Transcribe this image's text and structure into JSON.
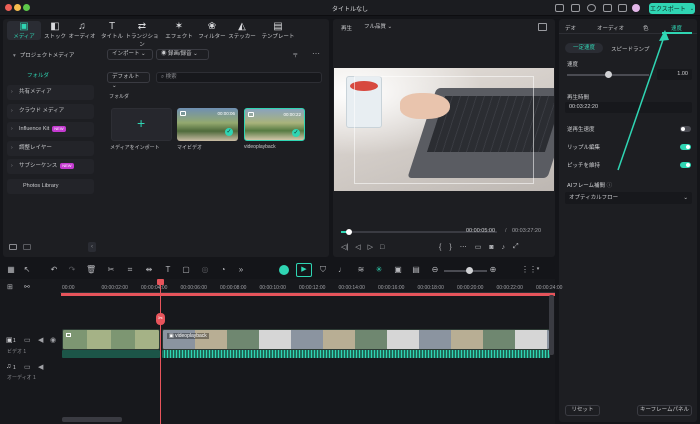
{
  "window": {
    "title": "タイトルなし",
    "export_label": "エクスポート"
  },
  "media_tabs": [
    {
      "label": "メディア",
      "icon": "media-icon",
      "glyph": "▣"
    },
    {
      "label": "ストック",
      "icon": "stock-icon",
      "glyph": "◧"
    },
    {
      "label": "オーディオ",
      "icon": "audio-icon",
      "glyph": "♫"
    },
    {
      "label": "タイトル",
      "icon": "title-icon",
      "glyph": "T"
    },
    {
      "label": "トランジション",
      "icon": "transition-icon",
      "glyph": "⇄"
    },
    {
      "label": "エフェクト",
      "icon": "effect-icon",
      "glyph": "✶"
    },
    {
      "label": "フィルター",
      "icon": "filter-icon",
      "glyph": "❀"
    },
    {
      "label": "ステッカー",
      "icon": "sticker-icon",
      "glyph": "◭"
    },
    {
      "label": "テンプレート",
      "icon": "template-icon",
      "glyph": "▤"
    }
  ],
  "sidebar": {
    "project_media": "プロジェクトメディア",
    "folder": "フォルダ",
    "items": [
      {
        "label": "共有メディア"
      },
      {
        "label": "クラウド メディア"
      },
      {
        "label": "Influence Kit",
        "badge": "NEW"
      },
      {
        "label": "調整レイヤー"
      },
      {
        "label": "サブシーケンス",
        "badge": "NEW"
      }
    ],
    "photos": "Photos Library"
  },
  "content": {
    "import_label": "インポート",
    "record_label": "録画/録音",
    "sort_label": "デフォルト",
    "search_placeholder": "検索",
    "folder_header": "フォルダ",
    "import_tile": "メディアをインポート",
    "items": [
      {
        "label": "マイビデオ",
        "duration": "00:00:06"
      },
      {
        "label": "videoplayback",
        "duration": "00:00:22"
      }
    ]
  },
  "preview": {
    "label": "再生",
    "quality": "フル品質",
    "current_time": "00:00:05:00",
    "separator": "/",
    "total_time": "00:03:27:20",
    "progress": 0.05
  },
  "properties": {
    "tabs": [
      "デオ",
      "オーディオ",
      "色",
      "速度"
    ],
    "subtabs": [
      "一定速度",
      "スピードランプ"
    ],
    "speed_label": "速度",
    "speed_value": "1.00",
    "playback_time_label": "再生時間",
    "playback_time": "00:03:22:20",
    "reverse": "逆再生速度",
    "ripple": "リップル編集",
    "pitch": "ピッチを維持",
    "ai_label": "AIフレーム補間",
    "ai_value": "オプティカルフロー",
    "reset": "リセット",
    "keyframe": "キーフレームパネル",
    "toggles": {
      "reverse": false,
      "ripple": true,
      "pitch": true
    },
    "accent": "#2fd5b3"
  },
  "ruler": [
    "00:00",
    "00:00:02:00",
    "00:00:04:00",
    "00:00:06:00",
    "00:00:08:00",
    "00:00:10:00",
    "00:00:12:00",
    "00:00:14:00",
    "00:00:16:00",
    "00:00:18:00",
    "00:00:20:00",
    "00:00:22:00",
    "00:00:24:00"
  ],
  "tracks": {
    "video_label": "ビデオ 1",
    "audio_label": "オーディオ 1",
    "clip_name": "videoplayback",
    "video_num": "1",
    "audio_num": "1"
  }
}
